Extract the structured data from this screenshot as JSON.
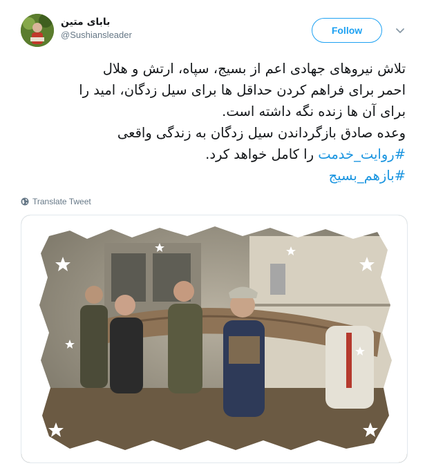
{
  "tweet": {
    "display_name": "بابای متین",
    "handle": "@Sushiansleader",
    "follow_label": "Follow",
    "text_lines": [
      "تلاش نیروهای جهادی اعم از بسیج، سپاه، ارتش و هلال",
      "احمر برای فراهم کردن حداقل ها برای سیل زدگان، امید را",
      "برای آن ها زنده نگه داشته است.",
      "وعده صادق بازگرداندن سیل زدگان به زندگی واقعی"
    ],
    "hashtag_1": "#روایت_خدمت",
    "line_after_hashtag_1": " را کامل خواهد کرد.",
    "hashtag_2": "#بازهم_بسیج",
    "translate_label": "Translate Tweet"
  },
  "colors": {
    "accent": "#1da1f2",
    "hashtag": "#1b95e0",
    "secondary_text": "#657786",
    "border": "#e1e8ed"
  },
  "icons": {
    "caret": "chevron-down-icon",
    "translate": "globe-icon"
  }
}
